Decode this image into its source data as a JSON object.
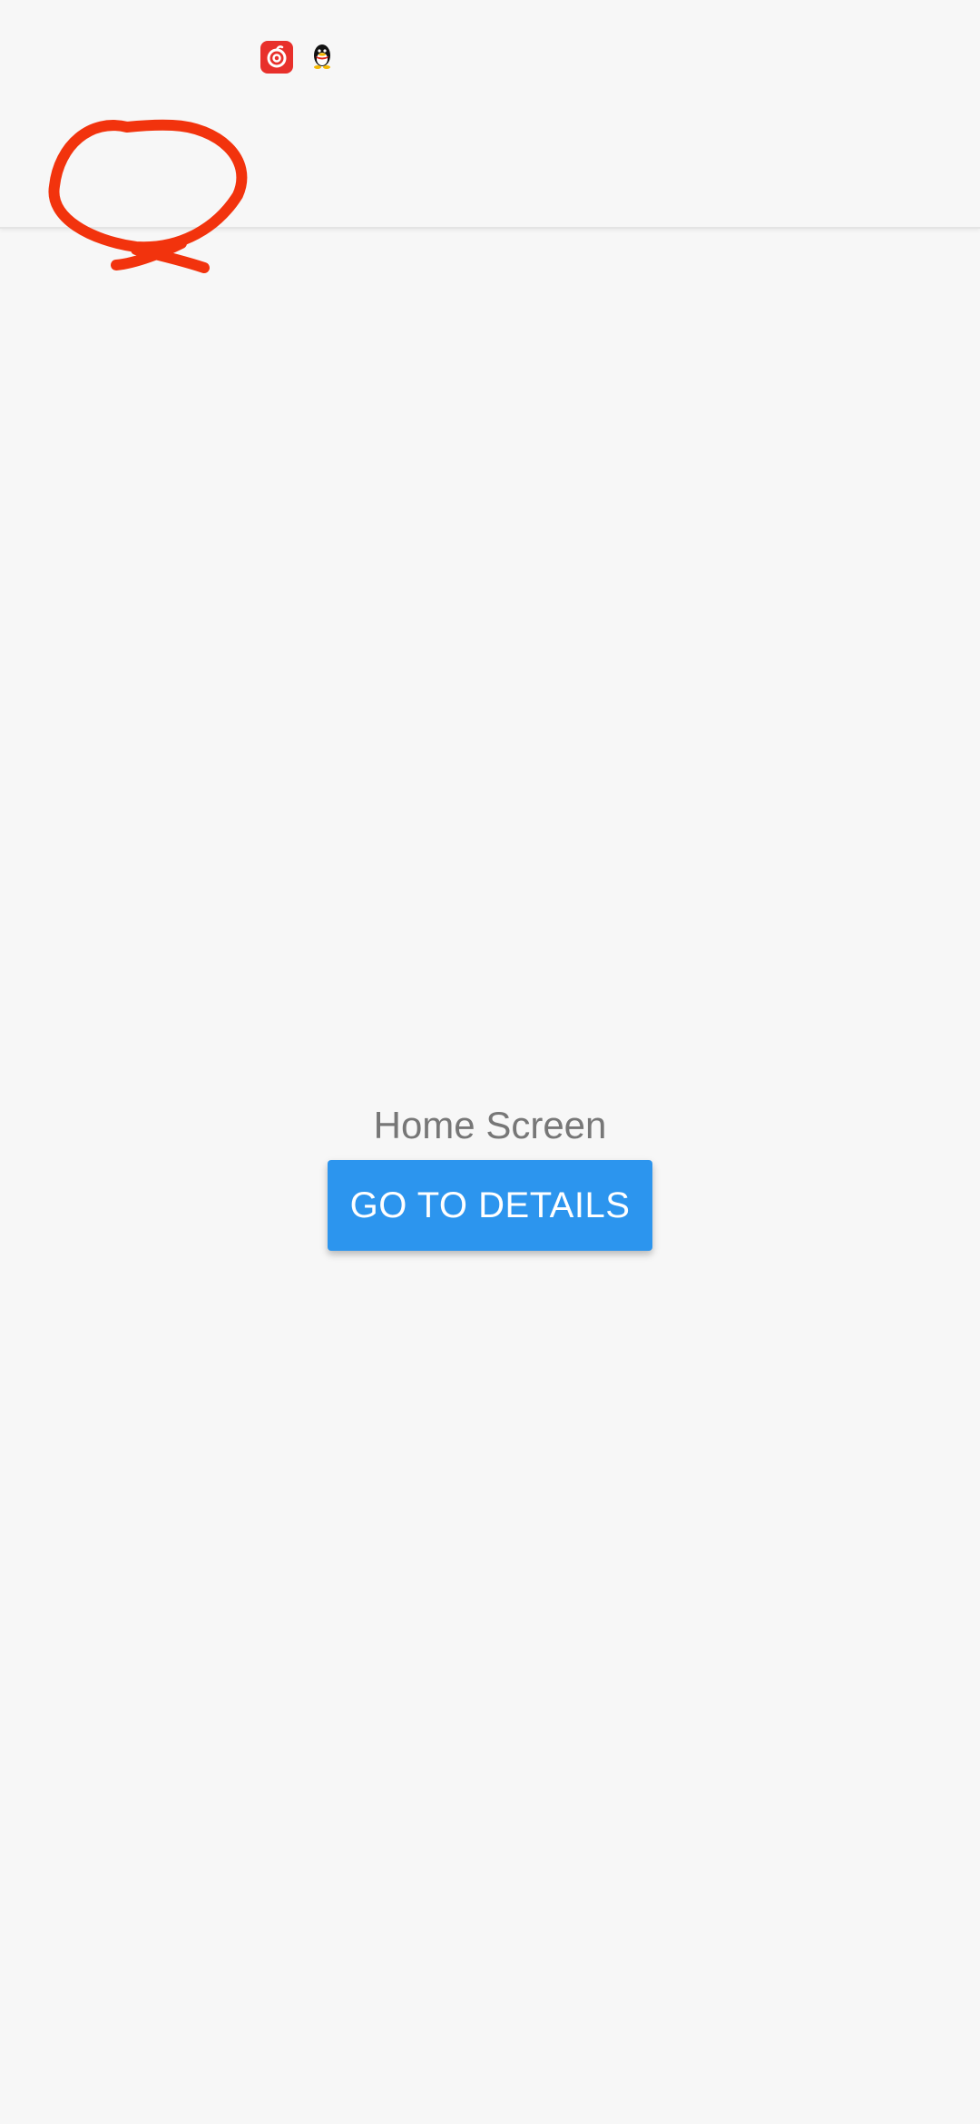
{
  "status_bar": {
    "icons": [
      {
        "name": "netease-music-icon",
        "color": "#e8302b"
      },
      {
        "name": "qq-penguin-icon",
        "color": "#111111"
      }
    ]
  },
  "annotation": {
    "type": "hand-drawn circle",
    "color": "#f2330d"
  },
  "main": {
    "title": "Home Screen",
    "button_label": "GO TO DETAILS",
    "button_color": "#2c95ee"
  }
}
